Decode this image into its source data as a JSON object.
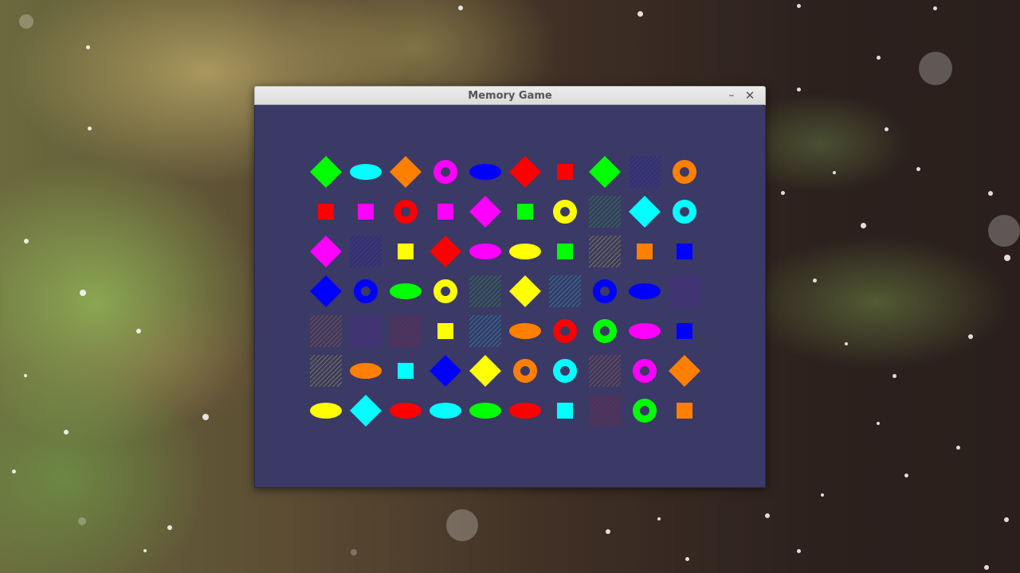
{
  "window": {
    "title": "Memory Game",
    "minimize_icon": "minimize-icon",
    "close_icon": "close-icon"
  },
  "colors": {
    "green": "#00ff00",
    "cyan": "#00ffff",
    "orange": "#ff8000",
    "magenta": "#ff00ff",
    "blue": "#0000ff",
    "red": "#ff0000",
    "yellow": "#ffff00",
    "purple": "#8000ff",
    "background": "#3b3966"
  },
  "board": {
    "rows": [
      [
        [
          "diamond",
          "green"
        ],
        [
          "oval",
          "cyan"
        ],
        [
          "diamond",
          "orange"
        ],
        [
          "donut",
          "magenta"
        ],
        [
          "oval",
          "blue"
        ],
        [
          "diamond",
          "red"
        ],
        [
          "square",
          "red"
        ],
        [
          "diamond",
          "green"
        ],
        [
          "lines",
          "blue"
        ],
        [
          "donut",
          "orange"
        ]
      ],
      [
        [
          "square",
          "red"
        ],
        [
          "square",
          "magenta"
        ],
        [
          "donut",
          "red"
        ],
        [
          "square",
          "magenta"
        ],
        [
          "diamond",
          "magenta"
        ],
        [
          "square",
          "green"
        ],
        [
          "donut",
          "yellow"
        ],
        [
          "lines",
          "green"
        ],
        [
          "diamond",
          "cyan"
        ],
        [
          "donut",
          "cyan"
        ]
      ],
      [
        [
          "diamond",
          "magenta"
        ],
        [
          "lines",
          "blue"
        ],
        [
          "square",
          "yellow"
        ],
        [
          "diamond",
          "red"
        ],
        [
          "oval",
          "magenta"
        ],
        [
          "oval",
          "yellow"
        ],
        [
          "square",
          "green"
        ],
        [
          "lines",
          "yellow"
        ],
        [
          "square",
          "orange"
        ],
        [
          "square",
          "blue"
        ]
      ],
      [
        [
          "diamond",
          "blue"
        ],
        [
          "donut",
          "blue"
        ],
        [
          "oval",
          "green"
        ],
        [
          "donut",
          "yellow"
        ],
        [
          "lines",
          "green"
        ],
        [
          "diamond",
          "yellow"
        ],
        [
          "lines",
          "cyan"
        ],
        [
          "donut",
          "blue"
        ],
        [
          "oval",
          "blue"
        ],
        [
          "lines",
          "purple"
        ]
      ],
      [
        [
          "lines",
          "orange"
        ],
        [
          "lines",
          "purple"
        ],
        [
          "lines",
          "red"
        ],
        [
          "square",
          "yellow"
        ],
        [
          "lines",
          "cyan"
        ],
        [
          "oval",
          "orange"
        ],
        [
          "donut",
          "red"
        ],
        [
          "donut",
          "green"
        ],
        [
          "oval",
          "magenta"
        ],
        [
          "square",
          "blue"
        ]
      ],
      [
        [
          "lines",
          "yellow"
        ],
        [
          "oval",
          "orange"
        ],
        [
          "square",
          "cyan"
        ],
        [
          "diamond",
          "blue"
        ],
        [
          "diamond",
          "yellow"
        ],
        [
          "donut",
          "orange"
        ],
        [
          "donut",
          "cyan"
        ],
        [
          "lines",
          "orange"
        ],
        [
          "donut",
          "magenta"
        ],
        [
          "diamond",
          "orange"
        ]
      ],
      [
        [
          "oval",
          "yellow"
        ],
        [
          "diamond",
          "cyan"
        ],
        [
          "oval",
          "red"
        ],
        [
          "oval",
          "cyan"
        ],
        [
          "oval",
          "green"
        ],
        [
          "oval",
          "red"
        ],
        [
          "square",
          "cyan"
        ],
        [
          "lines",
          "red"
        ],
        [
          "donut",
          "green"
        ],
        [
          "square",
          "orange"
        ]
      ]
    ]
  }
}
